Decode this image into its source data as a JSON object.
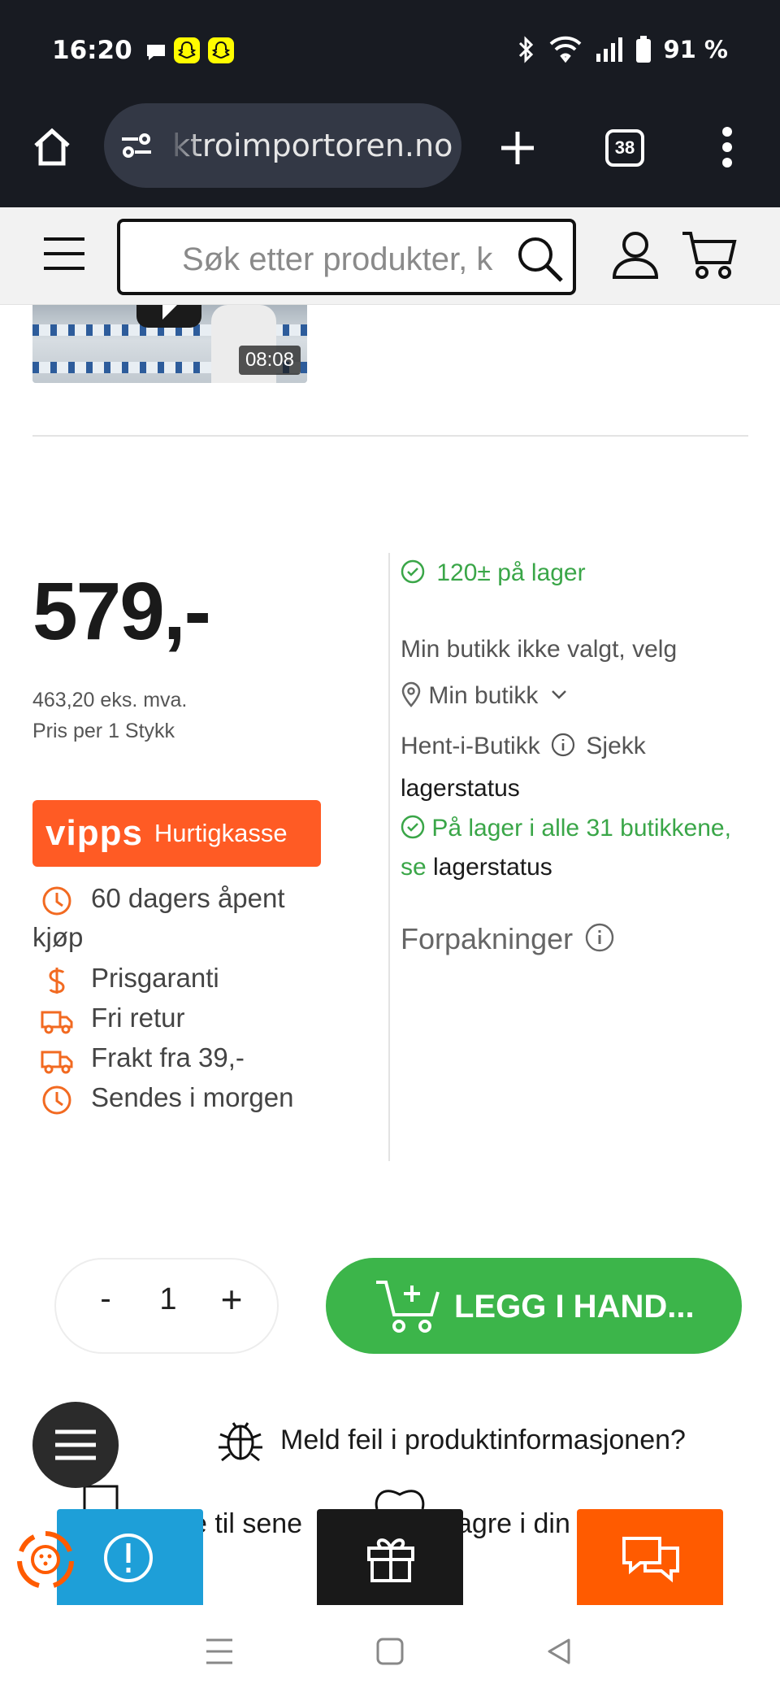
{
  "status_bar": {
    "time": "16:20",
    "battery": "91 %",
    "icons": [
      "message-icon",
      "snapchat-icon",
      "snapchat-icon",
      "bluetooth-icon",
      "wifi-icon",
      "signal-icon",
      "battery-icon"
    ]
  },
  "browser": {
    "url": "ktroimportoren.no",
    "tab_count": "38",
    "icons": [
      "home-icon",
      "site-settings-icon",
      "new-tab-icon",
      "menu-dots-icon"
    ]
  },
  "header": {
    "search_placeholder": "Søk etter produkter, k",
    "icons": [
      "hamburger-menu-icon",
      "search-icon",
      "account-icon",
      "cart-icon"
    ]
  },
  "video": {
    "duration": "08:08"
  },
  "price": {
    "amount": "579,-",
    "ex_vat": "463,20 eks. mva.",
    "per_unit": "Pris per 1 Stykk"
  },
  "vipps": {
    "logo": "vipps",
    "label": "Hurtigkasse",
    "color": "#ff5b24"
  },
  "usps": {
    "open_purchase_1": "60 dagers åpent",
    "open_purchase_2": "kjøp",
    "price_guarantee": "Prisgaranti",
    "free_return": "Fri retur",
    "shipping": "Frakt fra 39,-",
    "ships": "Sendes i morgen"
  },
  "stock": {
    "online": "120± på lager",
    "store_not_selected": "Min butikk ikke valgt, velg",
    "my_store": "Min butikk",
    "click_collect": "Hent-i-Butikk",
    "check": "Sjekk",
    "stock_status": "lagerstatus",
    "all_stores": "På lager i alle 31 butikkene,",
    "see": "se",
    "stock_status_link": "lagerstatus",
    "packaging": "Forpakninger"
  },
  "cart": {
    "minus": "-",
    "quantity": "1",
    "plus": "+",
    "add_label": "LEGG I HAND...",
    "color": "#3cb54a"
  },
  "report": {
    "label": "Meld feil i produktinformasjonen?"
  },
  "partially_hidden": {
    "recent": "e til sene",
    "save": "agre i din"
  },
  "colors": {
    "accent_orange": "#ff5b24",
    "stock_green": "#3aa648",
    "chrome_dark": "#181b22"
  }
}
